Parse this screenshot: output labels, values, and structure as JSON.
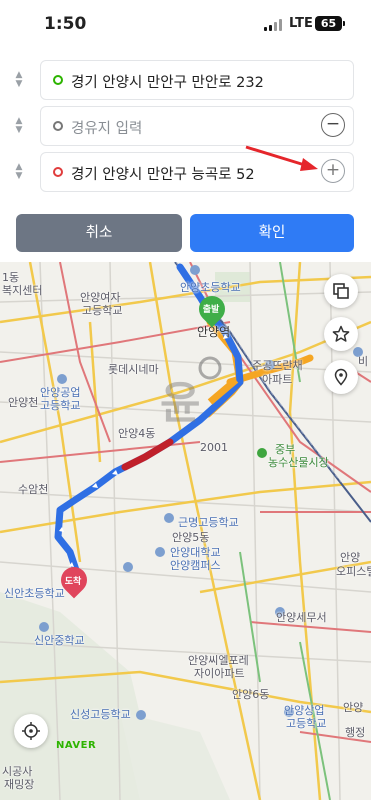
{
  "status_bar": {
    "time": "1:50",
    "network": "LTE",
    "battery": "65"
  },
  "route": {
    "start": "경기 안양시 만안구 만안로 232",
    "waypoint_placeholder": "경유지 입력",
    "end": "경기 안양시 만안구 능곡로 52",
    "remove_symbol": "−",
    "add_symbol": "+"
  },
  "actions": {
    "cancel": "취소",
    "confirm": "확인"
  },
  "map": {
    "labels": {
      "l1": "1동",
      "l2": "복지센터",
      "l3": "안양여자",
      "l4": "고등학교",
      "l5": "안양초등학교",
      "l6": "안양역",
      "l7": "롯데시네마",
      "l8": "안양공업",
      "l9": "고등학교",
      "l10": "안양천",
      "l11": "주공뜨란채",
      "l12": "아파트",
      "l13": "안양4동",
      "l14": "2001",
      "l15": "중부",
      "l16": "농수산물시장",
      "l17": "수암천",
      "l18": "근명고등학교",
      "l19": "안양5동",
      "l20": "안양대학교",
      "l21": "안양캠퍼스",
      "l22": "안양",
      "l23": "오피스텔",
      "l24": "신안초등학교",
      "l25": "신안중학교",
      "l26": "안양세무서",
      "l27": "안양씨엘포레",
      "l28": "자이아파트",
      "l29": "안양6동",
      "l30": "안양상업",
      "l31": "고등학교",
      "l32": "신성고등학교",
      "l33": "시공사",
      "l34": "재밍장",
      "l35": "비",
      "l36": "안양",
      "l37": "행정"
    },
    "start_pin": "출발",
    "end_pin": "도착",
    "watermark": "윤",
    "naver": "NAVER"
  },
  "colors": {
    "route_blue": "#2f6fe4",
    "route_red": "#c0202a",
    "route_orange": "#f5a623",
    "confirm": "#2f7bf5",
    "cancel": "#6d7684"
  }
}
